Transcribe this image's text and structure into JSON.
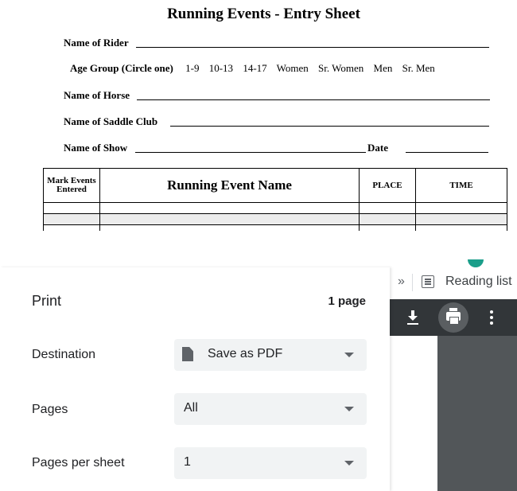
{
  "document": {
    "title": "Running Events - Entry Sheet",
    "fields": {
      "rider": "Name of Rider",
      "horse": "Name of Horse",
      "saddle_club": "Name of Saddle Club",
      "show": "Name of Show",
      "date": "Date"
    },
    "age_group": {
      "label": "Age Group (Circle one)",
      "options": [
        "1-9",
        "10-13",
        "14-17",
        "Women",
        "Sr. Women",
        "Men",
        "Sr. Men"
      ]
    },
    "table": {
      "headers": {
        "mark": "Mark Events Entered",
        "event": "Running Event Name",
        "place": "PLACE",
        "time": "TIME"
      }
    }
  },
  "print_dialog": {
    "title": "Print",
    "page_count": "1 page",
    "destination": {
      "label": "Destination",
      "value": "Save as PDF"
    },
    "pages": {
      "label": "Pages",
      "value": "All"
    },
    "pages_per_sheet": {
      "label": "Pages per sheet",
      "value": "1"
    }
  },
  "browser_toolbar": {
    "overflow_chevron": "»",
    "reading_list": "Reading list"
  }
}
